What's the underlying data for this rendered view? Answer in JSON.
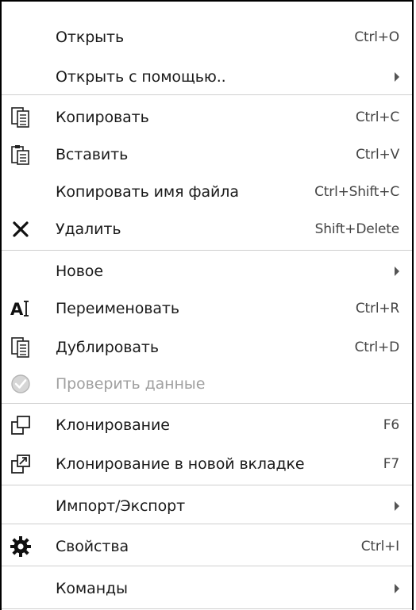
{
  "menu": {
    "items": [
      {
        "label": "Открыть",
        "shortcut": "Ctrl+O",
        "icon": ""
      },
      {
        "label": "Открыть с помощью..",
        "shortcut": "",
        "icon": "",
        "submenu": true
      },
      {
        "label": "Копировать",
        "shortcut": "Ctrl+C",
        "icon": "copy-icon"
      },
      {
        "label": "Вставить",
        "shortcut": "Ctrl+V",
        "icon": "paste-icon"
      },
      {
        "label": "Копировать имя файла",
        "shortcut": "Ctrl+Shift+C",
        "icon": ""
      },
      {
        "label": "Удалить",
        "shortcut": "Shift+Delete",
        "icon": "delete-icon"
      },
      {
        "label": "Новое",
        "shortcut": "",
        "icon": "",
        "submenu": true
      },
      {
        "label": "Переименовать",
        "shortcut": "Ctrl+R",
        "icon": "rename-icon"
      },
      {
        "label": "Дублировать",
        "shortcut": "Ctrl+D",
        "icon": "duplicate-icon"
      },
      {
        "label": "Проверить данные",
        "shortcut": "",
        "icon": "check-icon",
        "disabled": true
      },
      {
        "label": "Клонирование",
        "shortcut": "F6",
        "icon": "clone-icon"
      },
      {
        "label": "Клонирование в новой вкладке",
        "shortcut": "F7",
        "icon": "clone-new-tab-icon"
      },
      {
        "label": "Импорт/Экспорт",
        "shortcut": "",
        "icon": "",
        "submenu": true
      },
      {
        "label": "Свойства",
        "shortcut": "Ctrl+I",
        "icon": "gear-icon"
      },
      {
        "label": "Команды",
        "shortcut": "",
        "icon": "",
        "submenu": true
      }
    ]
  },
  "colors": {
    "text": "#1a1a1a",
    "shortcut": "#444444",
    "disabled": "#a0a0a0",
    "separator": "#cfcfcf"
  }
}
